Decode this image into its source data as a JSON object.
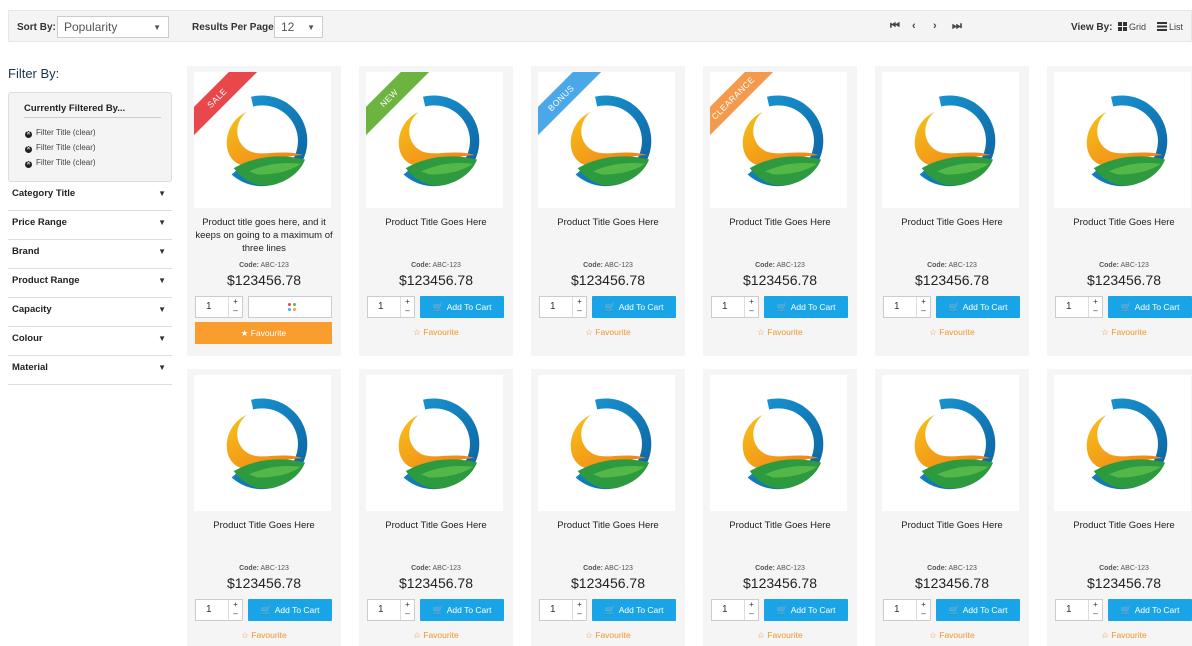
{
  "toolbar": {
    "sort_label": "Sort By:",
    "sort_value": "Popularity",
    "per_page_label": "Results Per Page:",
    "per_page_value": "12",
    "pager": {
      "first": "⏮",
      "prev": "‹",
      "next": "›",
      "last": "⏭"
    },
    "view_label": "View By:",
    "view_grid": "Grid",
    "view_list": "List"
  },
  "sidebar": {
    "heading": "Filter By:",
    "current_title": "Currently Filtered By...",
    "current_filters": [
      "Filter Title (clear)",
      "Filter Title (clear)",
      "Filter Title (clear)"
    ],
    "facets": [
      "Category Title",
      "Price Range",
      "Brand",
      "Product Range",
      "Capacity",
      "Colour",
      "Material"
    ]
  },
  "colors": {
    "cart_blue": "#1aa4e8",
    "favourite_orange": "#f89d2e",
    "ribbon_sale": "#e8474c",
    "ribbon_new": "#6db33f",
    "ribbon_bonus": "#4aa8e8",
    "ribbon_clearance": "#f39a4c"
  },
  "products": [
    {
      "ribbon": "SALE",
      "ribbon_color": "#e8474c",
      "title": "Product title goes here, and it keeps on going to a maximum of three lines",
      "code_label": "Code:",
      "code": "ABC-123",
      "price": "$123456.78",
      "qty": "1",
      "button": "loading",
      "favourite": "★ Favourite",
      "favourite_active": true
    },
    {
      "ribbon": "NEW",
      "ribbon_color": "#6db33f",
      "title": "Product Title Goes Here",
      "code_label": "Code:",
      "code": "ABC-123",
      "price": "$123456.78",
      "qty": "1",
      "button": "Add To Cart",
      "favourite": "☆ Favourite",
      "favourite_active": false
    },
    {
      "ribbon": "BONUS",
      "ribbon_color": "#4aa8e8",
      "title": "Product Title Goes Here",
      "code_label": "Code:",
      "code": "ABC-123",
      "price": "$123456.78",
      "qty": "1",
      "button": "Add To Cart",
      "favourite": "☆ Favourite",
      "favourite_active": false
    },
    {
      "ribbon": "CLEARANCE",
      "ribbon_color": "#f39a4c",
      "title": "Product Title Goes Here",
      "code_label": "Code:",
      "code": "ABC-123",
      "price": "$123456.78",
      "qty": "1",
      "button": "Add To Cart",
      "favourite": "☆ Favourite",
      "favourite_active": false
    },
    {
      "ribbon": "",
      "ribbon_color": "",
      "title": "Product Title Goes Here",
      "code_label": "Code:",
      "code": "ABC-123",
      "price": "$123456.78",
      "qty": "1",
      "button": "Add To Cart",
      "favourite": "☆ Favourite",
      "favourite_active": false
    },
    {
      "ribbon": "",
      "ribbon_color": "",
      "title": "Product Title Goes Here",
      "code_label": "Code:",
      "code": "ABC-123",
      "price": "$123456.78",
      "qty": "1",
      "button": "Add To Cart",
      "favourite": "☆ Favourite",
      "favourite_active": false
    },
    {
      "ribbon": "",
      "ribbon_color": "",
      "title": "Product Title Goes Here",
      "code_label": "Code:",
      "code": "ABC-123",
      "price": "$123456.78",
      "qty": "1",
      "button": "Add To Cart",
      "favourite": "☆ Favourite",
      "favourite_active": false
    },
    {
      "ribbon": "",
      "ribbon_color": "",
      "title": "Product Title Goes Here",
      "code_label": "Code:",
      "code": "ABC-123",
      "price": "$123456.78",
      "qty": "1",
      "button": "Add To Cart",
      "favourite": "☆ Favourite",
      "favourite_active": false
    },
    {
      "ribbon": "",
      "ribbon_color": "",
      "title": "Product Title Goes Here",
      "code_label": "Code:",
      "code": "ABC-123",
      "price": "$123456.78",
      "qty": "1",
      "button": "Add To Cart",
      "favourite": "☆ Favourite",
      "favourite_active": false
    },
    {
      "ribbon": "",
      "ribbon_color": "",
      "title": "Product Title Goes Here",
      "code_label": "Code:",
      "code": "ABC-123",
      "price": "$123456.78",
      "qty": "1",
      "button": "Add To Cart",
      "favourite": "☆ Favourite",
      "favourite_active": false
    },
    {
      "ribbon": "",
      "ribbon_color": "",
      "title": "Product Title Goes Here",
      "code_label": "Code:",
      "code": "ABC-123",
      "price": "$123456.78",
      "qty": "1",
      "button": "Add To Cart",
      "favourite": "☆ Favourite",
      "favourite_active": false
    },
    {
      "ribbon": "",
      "ribbon_color": "",
      "title": "Product Title Goes Here",
      "code_label": "Code:",
      "code": "ABC-123",
      "price": "$123456.78",
      "qty": "1",
      "button": "Add To Cart",
      "favourite": "☆ Favourite",
      "favourite_active": false
    }
  ]
}
